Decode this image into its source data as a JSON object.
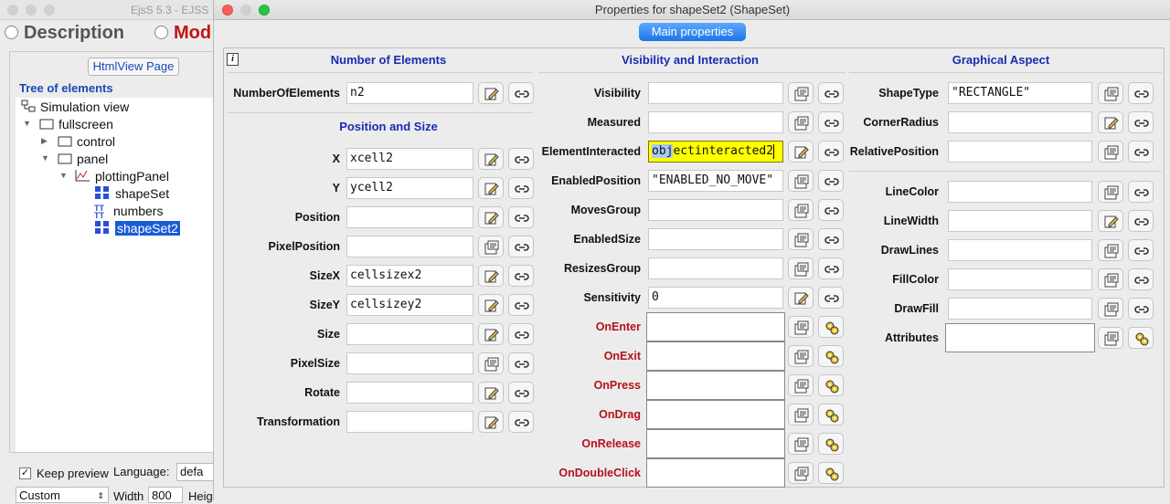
{
  "background_window": {
    "title": "EjsS 5.3 - EJSS",
    "tabs": [
      {
        "label": "Description"
      },
      {
        "label": "Mod"
      }
    ],
    "htmlview_button": "HtmlView Page",
    "tree_label": "Tree of elements",
    "tree": [
      {
        "label": "Simulation view"
      },
      {
        "label": "fullscreen"
      },
      {
        "label": "control"
      },
      {
        "label": "panel"
      },
      {
        "label": "plottingPanel"
      },
      {
        "label": "shapeSet"
      },
      {
        "label": "numbers"
      },
      {
        "label": "shapeSet2"
      }
    ],
    "keep_preview": "Keep preview",
    "language_label": "Language:",
    "language_value": "defa",
    "size_preset": "Custom",
    "width_label": "Width",
    "width_value": "800",
    "height_label": "Heig"
  },
  "dialog": {
    "title": "Properties for shapeSet2 (ShapeSet)",
    "main_properties": "Main properties",
    "info_icon": "i",
    "col1": {
      "heading_elements": "Number of Elements",
      "heading_position": "Position and Size",
      "rows_top": [
        {
          "label": "NumberOfElements",
          "value": "n2"
        }
      ],
      "rows": [
        {
          "label": "X",
          "value": "xcell2"
        },
        {
          "label": "Y",
          "value": "ycell2"
        },
        {
          "label": "Position",
          "value": ""
        },
        {
          "label": "PixelPosition",
          "value": ""
        },
        {
          "label": "SizeX",
          "value": "cellsizex2"
        },
        {
          "label": "SizeY",
          "value": "cellsizey2"
        },
        {
          "label": "Size",
          "value": ""
        },
        {
          "label": "PixelSize",
          "value": ""
        },
        {
          "label": "Rotate",
          "value": ""
        },
        {
          "label": "Transformation",
          "value": ""
        }
      ]
    },
    "col2": {
      "heading": "Visibility and Interaction",
      "rows": [
        {
          "label": "Visibility",
          "value": ""
        },
        {
          "label": "Measured",
          "value": ""
        },
        {
          "label": "ElementInteracted",
          "value_selected": "obj",
          "value_rest": "ectinteracted2"
        },
        {
          "label": "EnabledPosition",
          "value": "\"ENABLED_NO_MOVE\""
        },
        {
          "label": "MovesGroup",
          "value": ""
        },
        {
          "label": "EnabledSize",
          "value": ""
        },
        {
          "label": "ResizesGroup",
          "value": ""
        },
        {
          "label": "Sensitivity",
          "value": "0"
        }
      ],
      "actions": [
        {
          "label": "OnEnter",
          "value": ""
        },
        {
          "label": "OnExit",
          "value": ""
        },
        {
          "label": "OnPress",
          "value": ""
        },
        {
          "label": "OnDrag",
          "value": ""
        },
        {
          "label": "OnRelease",
          "value": ""
        },
        {
          "label": "OnDoubleClick",
          "value": ""
        }
      ]
    },
    "col3": {
      "heading": "Graphical Aspect",
      "rows_top": [
        {
          "label": "ShapeType",
          "value": "\"RECTANGLE\""
        },
        {
          "label": "CornerRadius",
          "value": ""
        },
        {
          "label": "RelativePosition",
          "value": ""
        }
      ],
      "rows": [
        {
          "label": "LineColor",
          "value": ""
        },
        {
          "label": "LineWidth",
          "value": ""
        },
        {
          "label": "DrawLines",
          "value": ""
        },
        {
          "label": "FillColor",
          "value": ""
        },
        {
          "label": "DrawFill",
          "value": ""
        },
        {
          "label": "Attributes",
          "value": ""
        }
      ]
    }
  }
}
